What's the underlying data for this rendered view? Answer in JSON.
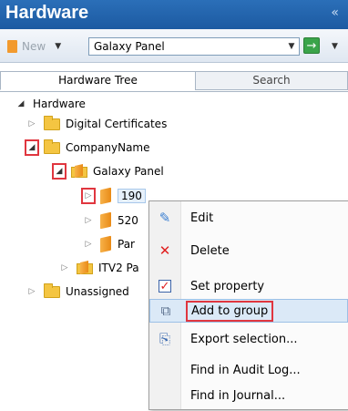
{
  "header": {
    "title": "Hardware",
    "collapse_glyph": "«"
  },
  "toolbar": {
    "new_label": "New",
    "panel_select_value": "Galaxy Panel",
    "go_glyph": "→"
  },
  "tabs": [
    {
      "label": "Hardware Tree",
      "active": true
    },
    {
      "label": "Search",
      "active": false
    }
  ],
  "tree": {
    "root": "Hardware",
    "digital_certificates": "Digital Certificates",
    "company": "CompanyName",
    "galaxy_panel": "Galaxy Panel",
    "child_190": "190",
    "child_520": "520",
    "child_par": "Par",
    "itv2": "ITV2 Pa",
    "unassigned": "Unassigned"
  },
  "context_menu": {
    "items": [
      {
        "label": "Edit",
        "icon": "edit-icon"
      },
      {
        "label": "Delete",
        "icon": "delete-icon"
      },
      {
        "label": "Set property",
        "icon": "set-property-icon"
      },
      {
        "label": "Add to group",
        "icon": "add-to-group-icon"
      },
      {
        "label": "Export selection...",
        "icon": "export-icon"
      },
      {
        "label": "Find in Audit Log...",
        "icon": ""
      },
      {
        "label": "Find in Journal...",
        "icon": ""
      }
    ]
  },
  "colors": {
    "header_bg": "#1c5aa2",
    "highlight_border": "#e0363f",
    "hover": "#dbe9f7"
  }
}
